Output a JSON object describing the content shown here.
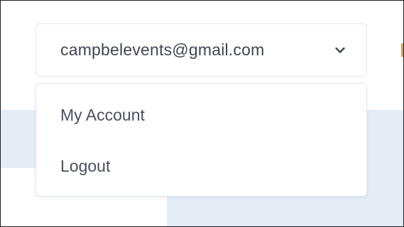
{
  "account": {
    "email": "campbelevents@gmail.com",
    "chevron_icon": "chevron-down-icon"
  },
  "menu": {
    "items": [
      {
        "label": "My Account"
      },
      {
        "label": "Logout"
      }
    ]
  },
  "colors": {
    "background_band": "#e4edf6",
    "border": "#e3e6ea",
    "text": "#3f4653",
    "accent_partial": "#d4a062"
  }
}
